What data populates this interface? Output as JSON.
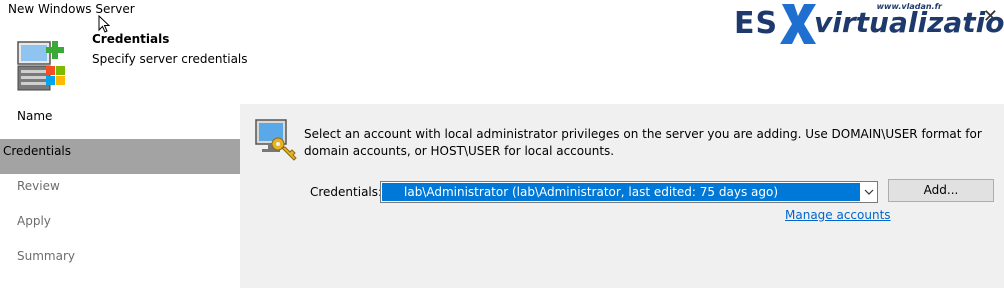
{
  "window": {
    "title": "New Windows Server"
  },
  "header": {
    "title": "Credentials",
    "subtitle": "Specify server credentials"
  },
  "brand": {
    "text_es": "ES",
    "text_rest": "virtualization",
    "url": "www.vladan.fr"
  },
  "sidebar": {
    "items": [
      {
        "label": "Name",
        "state": "normal"
      },
      {
        "label": "Credentials",
        "state": "active"
      },
      {
        "label": "Review",
        "state": "dim"
      },
      {
        "label": "Apply",
        "state": "dim"
      },
      {
        "label": "Summary",
        "state": "dim"
      }
    ]
  },
  "main": {
    "description": "Select an account with local administrator privileges on the server you are adding. Use DOMAIN\\USER format for domain accounts, or HOST\\USER for local accounts.",
    "credentials_label": "Credentials:",
    "credentials_value": "lab\\Administrator (lab\\Administrator, last edited: 75 days ago)",
    "add_button": "Add...",
    "manage_link": "Manage accounts"
  },
  "colors": {
    "accent": "#0078d7",
    "sidebar_active": "#a3a3a3",
    "brand": "#1e3a6d",
    "link": "#0066cc"
  }
}
